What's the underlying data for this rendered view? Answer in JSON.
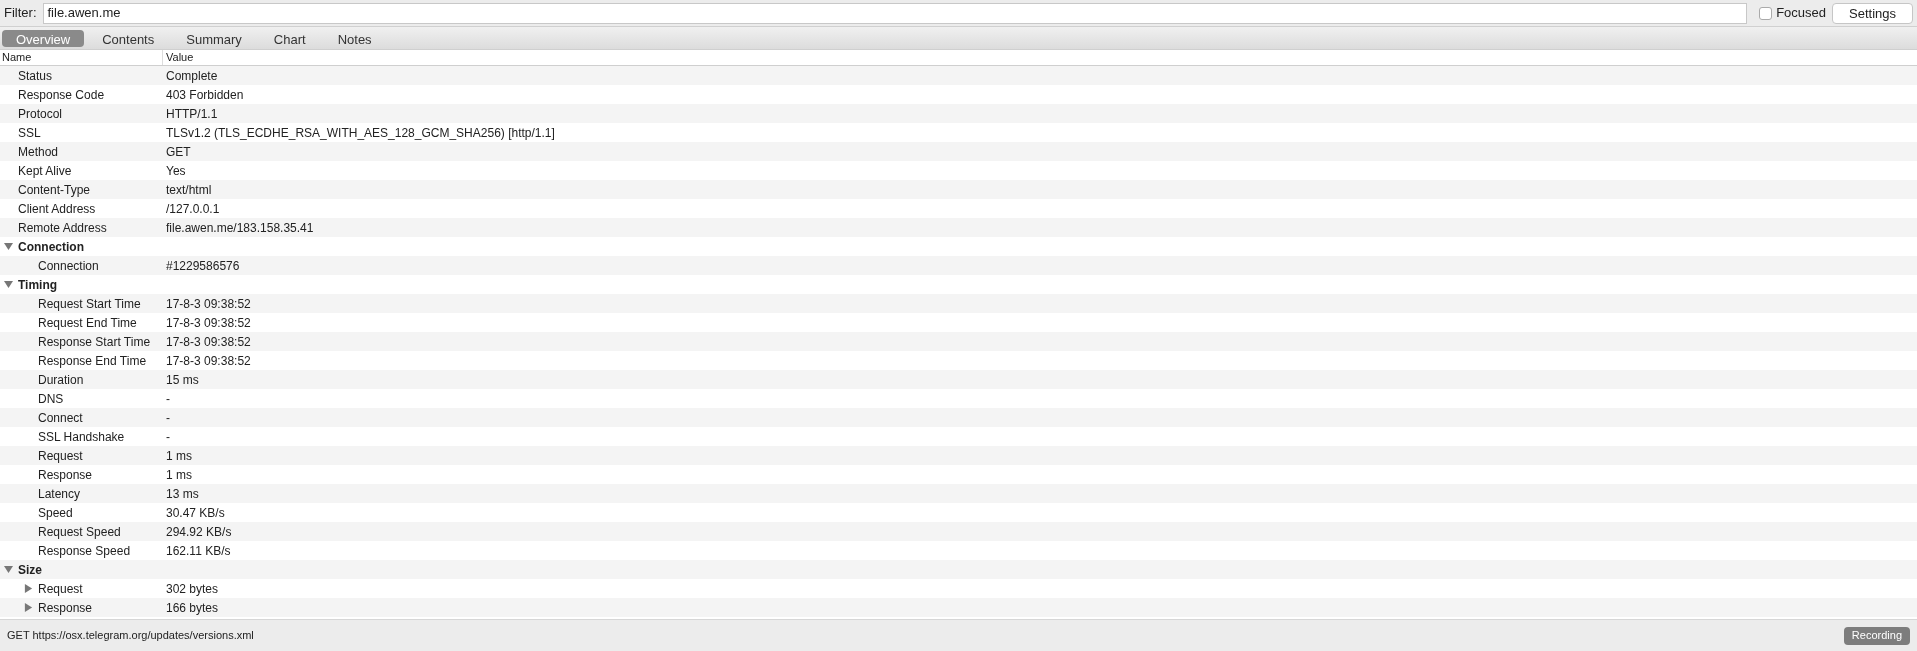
{
  "filter": {
    "label": "Filter:",
    "value": "file.awen.me"
  },
  "focused": {
    "label": "Focused",
    "checked": false
  },
  "settings_button": "Settings",
  "tabs": [
    {
      "label": "Overview",
      "selected": true
    },
    {
      "label": "Contents",
      "selected": false
    },
    {
      "label": "Summary",
      "selected": false
    },
    {
      "label": "Chart",
      "selected": false
    },
    {
      "label": "Notes",
      "selected": false
    }
  ],
  "table": {
    "columns": [
      "Name",
      "Value"
    ],
    "rows": [
      {
        "kind": "row",
        "name": "Status",
        "value": "Complete"
      },
      {
        "kind": "row",
        "name": "Response Code",
        "value": "403 Forbidden"
      },
      {
        "kind": "row",
        "name": "Protocol",
        "value": "HTTP/1.1"
      },
      {
        "kind": "row",
        "name": "SSL",
        "value": "TLSv1.2 (TLS_ECDHE_RSA_WITH_AES_128_GCM_SHA256) [http/1.1]"
      },
      {
        "kind": "row",
        "name": "Method",
        "value": "GET"
      },
      {
        "kind": "row",
        "name": "Kept Alive",
        "value": "Yes"
      },
      {
        "kind": "row",
        "name": "Content-Type",
        "value": "text/html"
      },
      {
        "kind": "row",
        "name": "Client Address",
        "value": "/127.0.0.1"
      },
      {
        "kind": "row",
        "name": "Remote Address",
        "value": "file.awen.me/183.158.35.41"
      },
      {
        "kind": "group",
        "name": "Connection",
        "expanded": true,
        "children": [
          {
            "kind": "row",
            "name": "Connection",
            "value": "#1229586576"
          }
        ]
      },
      {
        "kind": "group",
        "name": "Timing",
        "expanded": true,
        "children": [
          {
            "kind": "row",
            "name": "Request Start Time",
            "value": "17-8-3 09:38:52"
          },
          {
            "kind": "row",
            "name": "Request End Time",
            "value": "17-8-3 09:38:52"
          },
          {
            "kind": "row",
            "name": "Response Start Time",
            "value": "17-8-3 09:38:52"
          },
          {
            "kind": "row",
            "name": "Response End Time",
            "value": "17-8-3 09:38:52"
          },
          {
            "kind": "row",
            "name": "Duration",
            "value": "15 ms"
          },
          {
            "kind": "row",
            "name": "DNS",
            "value": "-"
          },
          {
            "kind": "row",
            "name": "Connect",
            "value": "-"
          },
          {
            "kind": "row",
            "name": "SSL Handshake",
            "value": "-"
          },
          {
            "kind": "row",
            "name": "Request",
            "value": "1 ms"
          },
          {
            "kind": "row",
            "name": "Response",
            "value": "1 ms"
          },
          {
            "kind": "row",
            "name": "Latency",
            "value": "13 ms"
          },
          {
            "kind": "row",
            "name": "Speed",
            "value": "30.47 KB/s"
          },
          {
            "kind": "row",
            "name": "Request Speed",
            "value": "294.92 KB/s"
          },
          {
            "kind": "row",
            "name": "Response Speed",
            "value": "162.11 KB/s"
          }
        ]
      },
      {
        "kind": "group",
        "name": "Size",
        "expanded": true,
        "children": [
          {
            "kind": "group",
            "name": "Request",
            "value": "302 bytes",
            "expanded": false
          },
          {
            "kind": "group",
            "name": "Response",
            "value": "166 bytes",
            "expanded": false
          }
        ]
      }
    ]
  },
  "status_bar": {
    "text": "GET https://osx.telegram.org/updates/versions.xml",
    "recording": "Recording"
  }
}
